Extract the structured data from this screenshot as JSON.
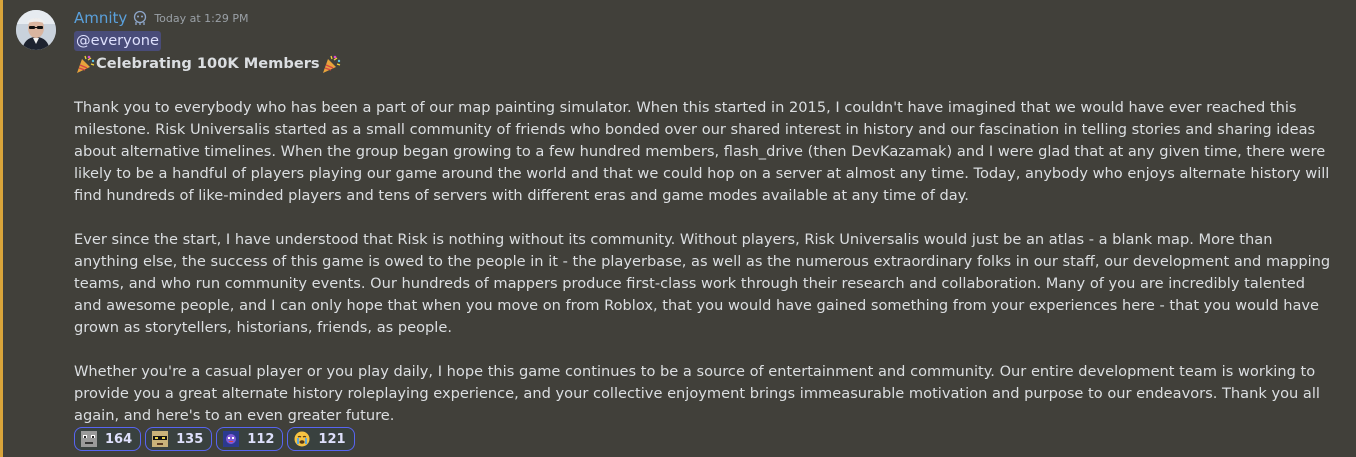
{
  "message": {
    "author": "Amnity",
    "timestamp": "Today at 1:29 PM",
    "mention": "@everyone",
    "title": "Celebrating 100K Members",
    "paragraphs": [
      "Thank you to everybody who has been a part of our map painting simulator. When this started in 2015, I couldn't have imagined that we would have ever reached this milestone. Risk Universalis started as a small community of friends who bonded over our shared interest in history and our fascination in telling stories and sharing ideas about alternative timelines. When the group began growing to a few hundred members, flash_drive (then DevKazamak) and I were glad that at any given time, there were likely to be a handful of players playing our game around the world and that we could hop on a server at almost any time. Today, anybody who enjoys alternate history will find hundreds of like-minded players and tens of servers with different eras and game modes available at any time of day.",
      "Ever since the start, I have understood that Risk is nothing without its community. Without players, Risk Universalis would just be an atlas - a blank map. More than anything else, the success of this game is owed to the people in it - the playerbase, as well as the numerous extraordinary folks in our staff, our development and mapping teams, and who run community events. Our hundreds of mappers produce first-class work through their research and collaboration. Many of you are incredibly talented and awesome people, and I can only hope that when you move on from Roblox, that you would have gained something from your experiences here - that you would have grown as storytellers, historians, friends, as people.",
      "Whether you're a casual player or you play daily, I hope this game continues to be a source of entertainment and community. Our entire development team is working to provide you a great alternate history roleplaying experience, and your collective enjoyment brings immeasurable motivation and purpose to our endeavors. Thank you all again, and here's to an even greater future."
    ],
    "reactions": [
      {
        "emoji": "pixel-face-emoji",
        "count": "164"
      },
      {
        "emoji": "sunglasses-pixel-emoji",
        "count": "135"
      },
      {
        "emoji": "character-emoji",
        "count": "112"
      },
      {
        "emoji": "crying-face-emoji",
        "count": "121"
      }
    ]
  },
  "colors": {
    "background": "#41403a",
    "mention_bar": "#d8a43a",
    "username": "#5aa0db",
    "reaction_border": "#5865f2"
  }
}
